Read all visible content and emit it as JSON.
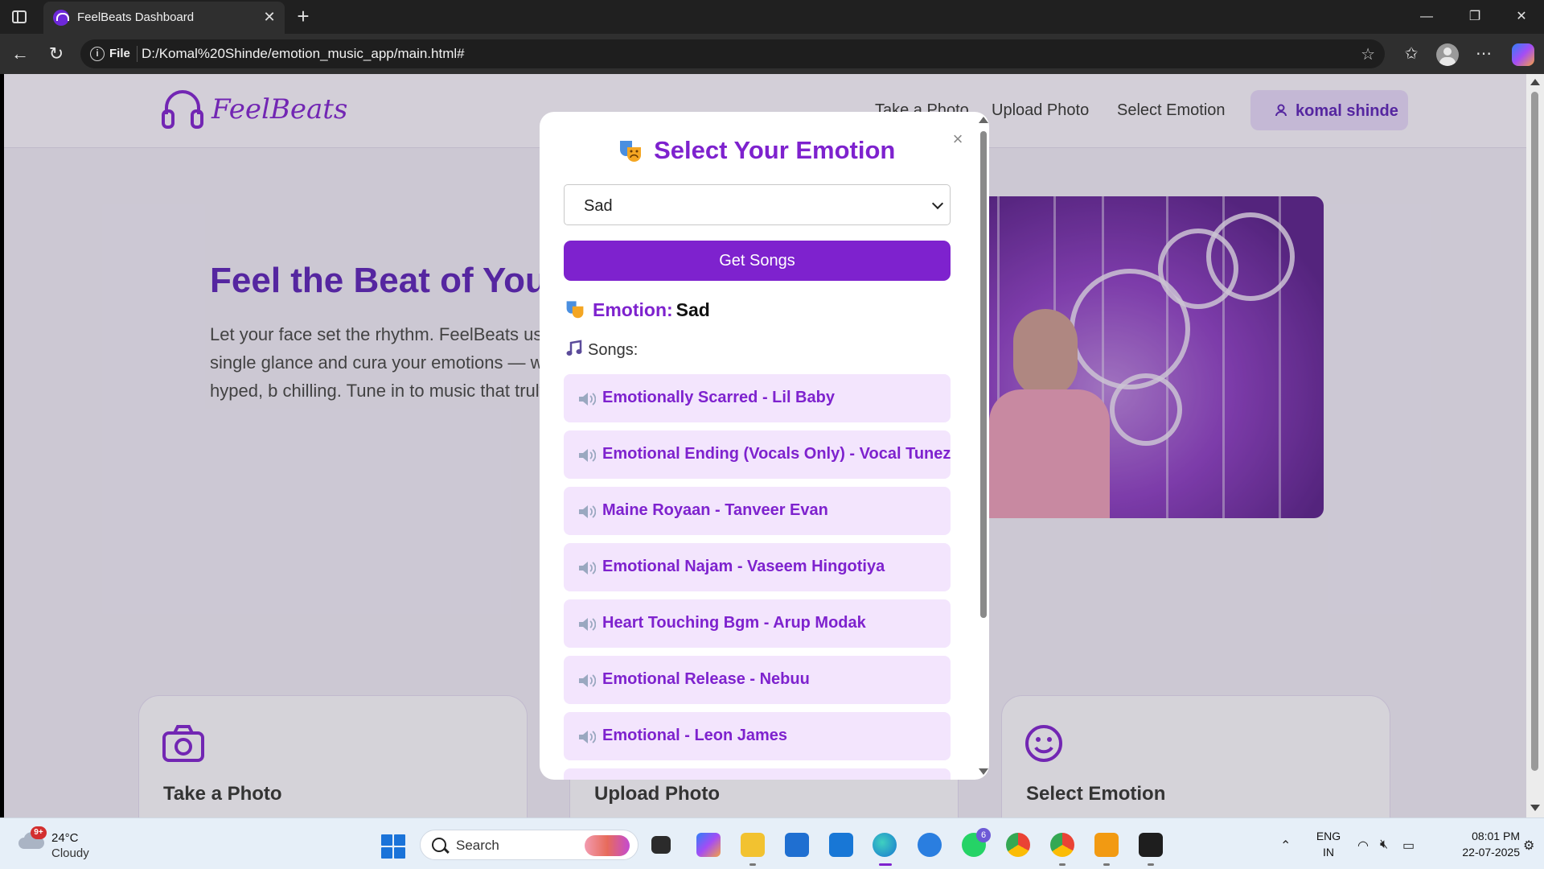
{
  "browser": {
    "tab_title": "FeelBeats Dashboard",
    "tab_close": "✕",
    "new_tab": "+",
    "address_scheme": "File",
    "address_url": "D:/Komal%20Shinde/emotion_music_app/main.html#",
    "icons": [
      "sidebar-toggle-icon",
      "back-icon",
      "reload-icon",
      "info-icon",
      "favorite-star-icon",
      "favorites-icon",
      "profile-icon",
      "more-icon",
      "copilot-icon"
    ]
  },
  "site": {
    "logo_text": "FeelBeats",
    "nav": {
      "take_photo": "Take a Photo",
      "upload_photo": "Upload Photo",
      "select_emotion": "Select Emotion",
      "user_name": "komal shinde"
    },
    "hero": {
      "title": "Feel the Beat of You",
      "text": "Let your face set the rhythm. FeelBeats us your mood from a single glance and cura your emotions — whether you're hyped, b chilling. Tune in to music that truly gets yo"
    },
    "features": {
      "take_photo": "Take a Photo",
      "upload_photo": "Upload Photo",
      "select_emotion": "Select Emotion"
    }
  },
  "modal": {
    "title": "Select Your Emotion",
    "close": "×",
    "selected_emotion": "Sad",
    "get_songs_label": "Get Songs",
    "emotion_label": "Emotion:",
    "emotion_value": "Sad",
    "songs_label": "Songs:",
    "songs": [
      "Emotionally Scarred - Lil Baby",
      "Emotional Ending (Vocals Only) - Vocal Tunez",
      "Maine Royaan - Tanveer Evan",
      "Emotional Najam - Vaseem Hingotiya",
      "Heart Touching Bgm - Arup Modak",
      "Emotional Release - Nebuu",
      "Emotional - Leon James"
    ]
  },
  "taskbar": {
    "weather_badge": "9+",
    "weather_temp": "24°C",
    "weather_desc": "Cloudy",
    "search_label": "Search",
    "whatsapp_badge": "6",
    "lang_top": "ENG",
    "lang_bottom": "IN",
    "time": "08:01 PM",
    "date": "22-07-2025"
  },
  "colors": {
    "brand": "#7e22ce",
    "brand_dark": "#5b21b6",
    "song_bg": "#f3e5fd"
  }
}
